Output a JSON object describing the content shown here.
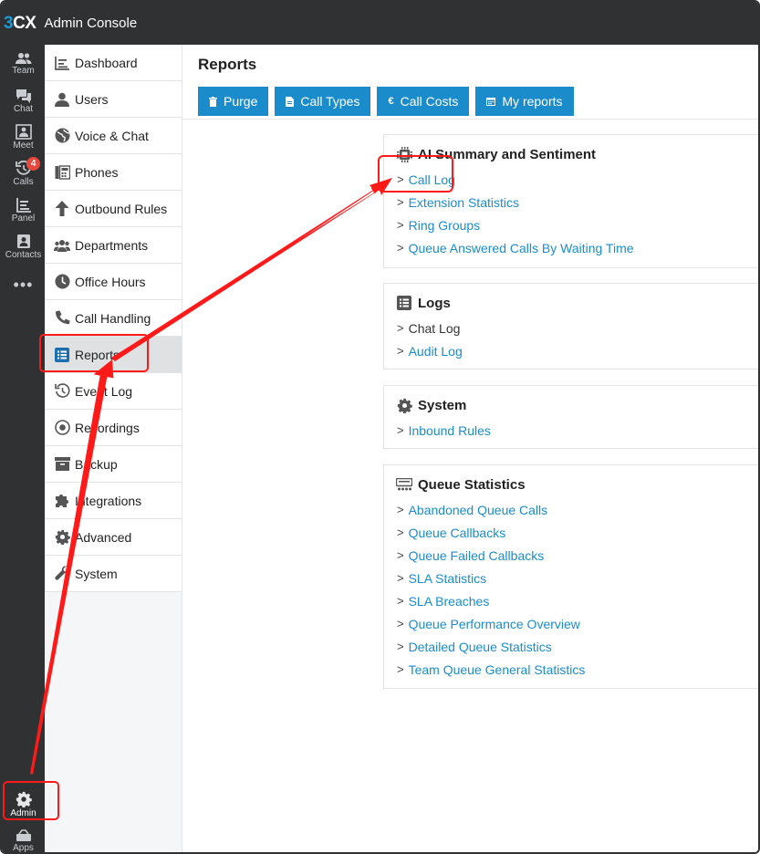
{
  "topbar": {
    "logo_three": "3",
    "logo_cx": "CX",
    "title": "Admin Console"
  },
  "rail": {
    "items": [
      {
        "label": "Team",
        "icon": "team-icon"
      },
      {
        "label": "Chat",
        "icon": "chat-icon"
      },
      {
        "label": "Meet",
        "icon": "meet-icon"
      },
      {
        "label": "Calls",
        "icon": "calls-icon",
        "badge": "4"
      },
      {
        "label": "Panel",
        "icon": "panel-icon"
      },
      {
        "label": "Contacts",
        "icon": "contacts-icon"
      }
    ],
    "more": "•••",
    "admin": "Admin",
    "apps": "Apps"
  },
  "sidenav": {
    "items": [
      {
        "label": "Dashboard",
        "icon": "dashboard-icon"
      },
      {
        "label": "Users",
        "icon": "user-icon"
      },
      {
        "label": "Voice & Chat",
        "icon": "globe-icon"
      },
      {
        "label": "Phones",
        "icon": "phone-grid-icon"
      },
      {
        "label": "Outbound Rules",
        "icon": "arrow-up-icon"
      },
      {
        "label": "Departments",
        "icon": "departments-icon"
      },
      {
        "label": "Office Hours",
        "icon": "clock-icon"
      },
      {
        "label": "Call Handling",
        "icon": "handset-icon"
      },
      {
        "label": "Reports",
        "icon": "reports-icon",
        "active": true
      },
      {
        "label": "Event Log",
        "icon": "history-icon"
      },
      {
        "label": "Recordings",
        "icon": "record-icon"
      },
      {
        "label": "Backup",
        "icon": "archive-icon"
      },
      {
        "label": "Integrations",
        "icon": "puzzle-icon"
      },
      {
        "label": "Advanced",
        "icon": "gear-icon"
      },
      {
        "label": "System",
        "icon": "wrench-icon"
      }
    ]
  },
  "main": {
    "title": "Reports",
    "toolbar": [
      {
        "label": "Purge",
        "icon": "trash-icon"
      },
      {
        "label": "Call Types",
        "icon": "document-icon"
      },
      {
        "label": "Call Costs",
        "icon": "euro-icon"
      },
      {
        "label": "My reports",
        "icon": "calendar-icon"
      }
    ]
  },
  "cards": [
    {
      "title": "AI Summary and Sentiment",
      "icon": "chip-icon",
      "links": [
        "Call Log",
        "Extension Statistics",
        "Ring Groups",
        "Queue Answered Calls By Waiting Time"
      ]
    },
    {
      "title": "Logs",
      "icon": "list-icon",
      "links": [
        "Chat Log",
        "Audit Log"
      ]
    },
    {
      "title": "System",
      "icon": "gear-icon",
      "links": [
        "Inbound Rules"
      ]
    },
    {
      "title": "Queue Statistics",
      "icon": "queue-icon",
      "links": [
        "Abandoned Queue Calls",
        "Queue Callbacks",
        "Queue Failed Callbacks",
        "SLA Statistics",
        "SLA Breaches",
        "Queue Performance Overview",
        "Detailed Queue Statistics",
        "Team Queue General Statistics"
      ]
    }
  ],
  "colors": {
    "accent": "#1b8ccb",
    "dark": "#2f3133",
    "annotation": "#ff1a1a"
  }
}
